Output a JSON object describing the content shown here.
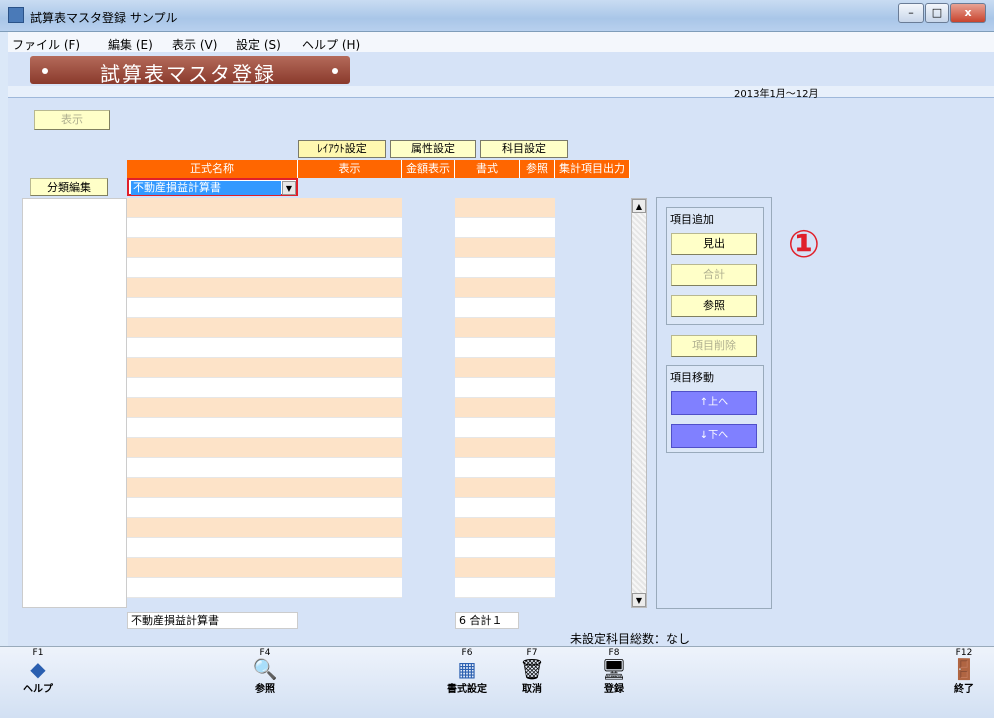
{
  "window": {
    "title": "試算表マスタ登録 サンプル",
    "minimize": "–",
    "maximize": "□",
    "close": "x"
  },
  "menu": [
    "ファイル (F)",
    "編集 (E)",
    "表示 (V)",
    "設定 (S)",
    "ヘルプ (H)"
  ],
  "banner": {
    "title": "試算表マスタ登録"
  },
  "period": "2013年1月～12月",
  "buttons": {
    "display": "表示",
    "bunrui": "分類編集"
  },
  "tabs": [
    "ﾚｲｱｳﾄ設定",
    "属性設定",
    "科目設定"
  ],
  "headers": [
    "正式名称",
    "表示",
    "金額表示",
    "書式",
    "参照",
    "集計項目出力"
  ],
  "combo": {
    "value": "不動産損益計算書",
    "arrow": "▼"
  },
  "side": {
    "add_group": "項目追加",
    "midashi": "見出",
    "goukei": "合計",
    "sansho": "参照",
    "delete": "項目削除",
    "move_group": "項目移動",
    "up": "↑上へ",
    "down": "↓下へ"
  },
  "scroll": {
    "up": "▲",
    "down": "▼"
  },
  "annotation": "①",
  "footer": {
    "name": "不動産損益計算書",
    "format": "6 合計１",
    "unset": "未設定科目総数：なし"
  },
  "fkeys": [
    {
      "key": "F1",
      "label": "ヘルプ",
      "icon": "◆"
    },
    {
      "key": "F4",
      "label": "参照",
      "icon": "🔍"
    },
    {
      "key": "F6",
      "label": "書式設定",
      "icon": "▦"
    },
    {
      "key": "F7",
      "label": "取消",
      "icon": "🗑"
    },
    {
      "key": "F8",
      "label": "登録",
      "icon": "🖥"
    },
    {
      "key": "F12",
      "label": "終了",
      "icon": "🚪"
    }
  ]
}
